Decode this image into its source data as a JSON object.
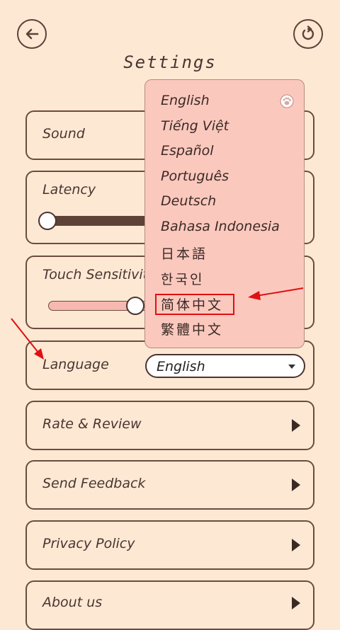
{
  "header": {
    "title": "Settings",
    "back_icon": "back-arrow-icon",
    "reset_icon": "refresh-icon"
  },
  "settings": {
    "sound_label": "Sound",
    "latency_label": "Latency",
    "latency_level": 0.0,
    "touch_label": "Touch Sensitivity",
    "touch_level": 0.5,
    "language_label": "Language",
    "language_value": "English",
    "rate_label": "Rate & Review",
    "feedback_label": "Send Feedback",
    "privacy_label": "Privacy Policy",
    "about_label": "About us"
  },
  "dropdown": {
    "options": [
      "English",
      "Tiếng Việt",
      "Español",
      "Português",
      "Deutsch",
      "Bahasa Indonesia",
      "日本語",
      "한국인",
      "简体中文",
      "繁體中文"
    ],
    "selected_icon": "paw-icon",
    "highlighted_option": "简体中文"
  },
  "colors": {
    "background": "#fde8d4",
    "border": "#6b4c3e",
    "dropdown_bg": "#fbc8be",
    "annotation_red": "#e01010",
    "slider_dark": "#5e4238",
    "slider_light": "#f6b8b0"
  }
}
